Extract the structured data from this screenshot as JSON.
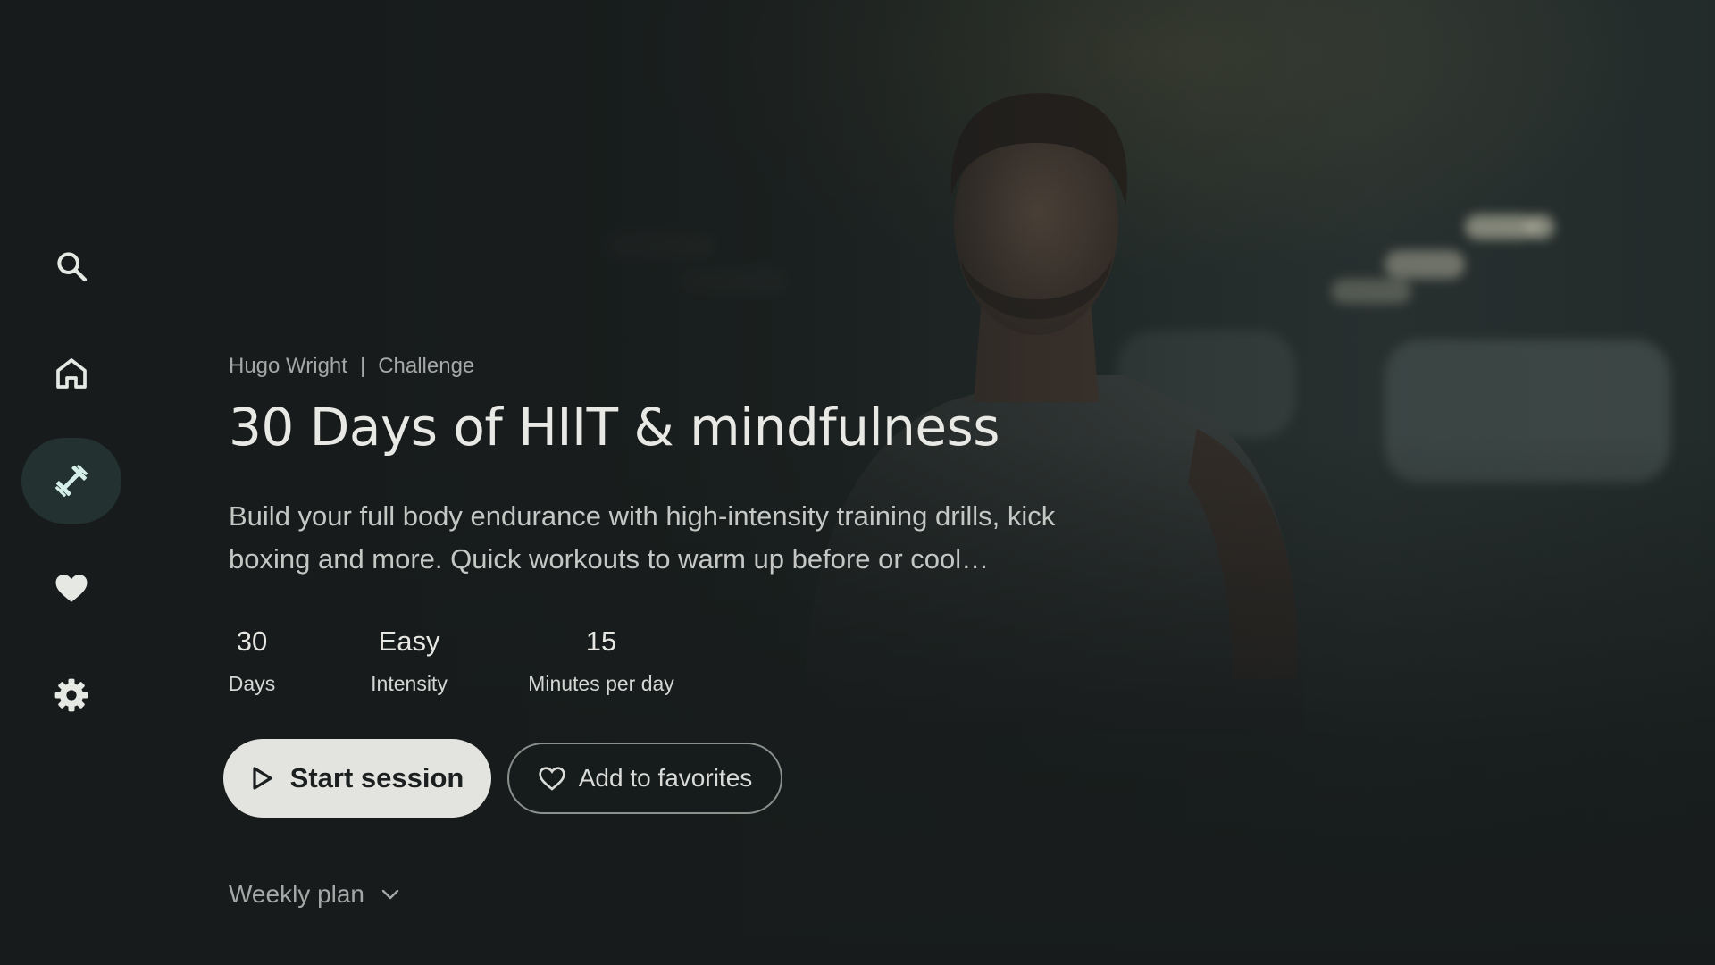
{
  "nav": {
    "items": [
      {
        "icon": "search-icon",
        "active": false
      },
      {
        "icon": "home-icon",
        "active": false
      },
      {
        "icon": "dumbbell-icon",
        "active": true
      },
      {
        "icon": "heart-icon",
        "active": false
      },
      {
        "icon": "settings-icon",
        "active": false
      }
    ]
  },
  "hero": {
    "instructor": "Hugo Wright",
    "separator": "|",
    "category": "Challenge",
    "title": "30 Days of HIIT & mindfulness",
    "description": "Build your full body endurance with high-intensity training drills, kick boxing and more. Quick workouts to warm up before or cool…"
  },
  "stats": [
    {
      "value": "30",
      "label": "Days"
    },
    {
      "value": "Easy",
      "label": "Intensity"
    },
    {
      "value": "15",
      "label": "Minutes per day"
    }
  ],
  "actions": {
    "start_label": "Start session",
    "start_icon": "play-icon",
    "favorite_label": "Add to favorites",
    "favorite_icon": "heart-outline-icon"
  },
  "weekly_plan": {
    "label": "Weekly plan",
    "icon": "chevron-down-icon"
  },
  "colors": {
    "background": "#171b1b",
    "active_nav": "#233230",
    "primary_button": "#e3e4e0",
    "icon": "#e6e8e4"
  }
}
